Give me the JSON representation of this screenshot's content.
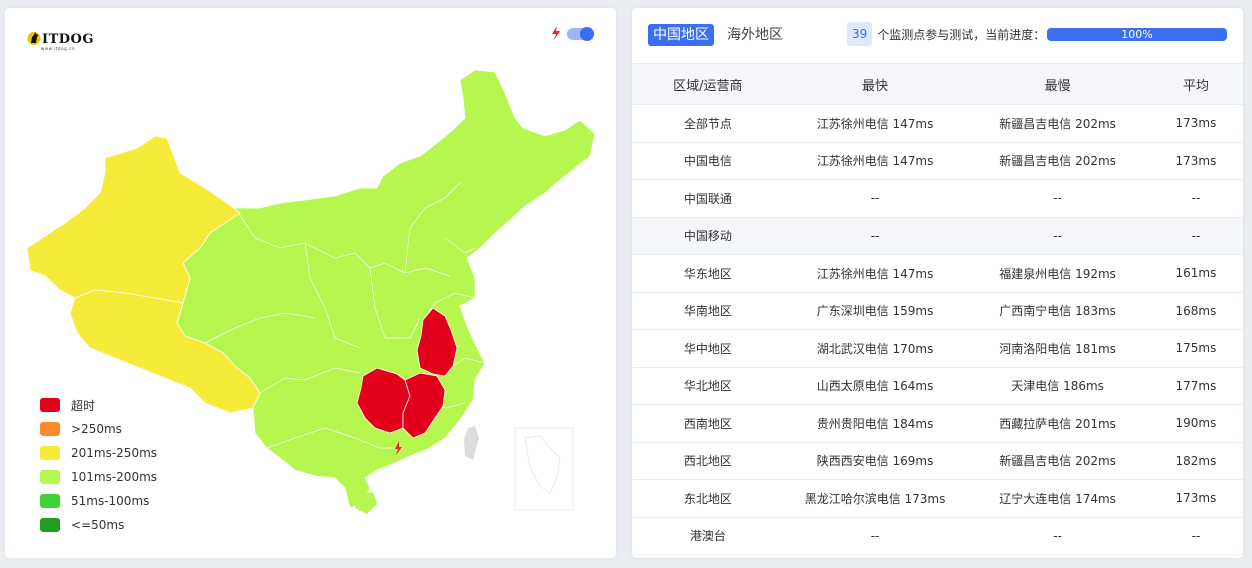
{
  "logo": {
    "text": "ITDOG",
    "sub": "www.itdog.cn"
  },
  "legend": [
    {
      "label": "超时",
      "color": "#e3001b"
    },
    {
      "label": ">250ms",
      "color": "#f98d2b"
    },
    {
      "label": "201ms-250ms",
      "color": "#f7eb39"
    },
    {
      "label": "101ms-200ms",
      "color": "#b5f74e"
    },
    {
      "label": "51ms-100ms",
      "color": "#3fd23b"
    },
    {
      "label": "<=50ms",
      "color": "#219e20"
    }
  ],
  "tabs": {
    "active": "中国地区",
    "inactive": "海外地区"
  },
  "status": {
    "count": "39",
    "text": "个监测点参与测试，当前进度：",
    "progress": "100%"
  },
  "table": {
    "headers": [
      "区域/运营商",
      "最快",
      "最慢",
      "平均"
    ],
    "rows": [
      [
        "全部节点",
        "江苏徐州电信 147ms",
        "新疆昌吉电信 202ms",
        "173ms"
      ],
      [
        "中国电信",
        "江苏徐州电信 147ms",
        "新疆昌吉电信 202ms",
        "173ms"
      ],
      [
        "中国联通",
        "--",
        "--",
        "--"
      ],
      [
        "中国移动",
        "--",
        "--",
        "--"
      ],
      [
        "华东地区",
        "江苏徐州电信 147ms",
        "福建泉州电信 192ms",
        "161ms"
      ],
      [
        "华南地区",
        "广东深圳电信 159ms",
        "广西南宁电信 183ms",
        "168ms"
      ],
      [
        "华中地区",
        "湖北武汉电信 170ms",
        "河南洛阳电信 181ms",
        "175ms"
      ],
      [
        "华北地区",
        "山西太原电信 164ms",
        "天津电信 186ms",
        "177ms"
      ],
      [
        "西南地区",
        "贵州贵阳电信 184ms",
        "西藏拉萨电信 201ms",
        "190ms"
      ],
      [
        "西北地区",
        "陕西西安电信 169ms",
        "新疆昌吉电信 202ms",
        "182ms"
      ],
      [
        "东北地区",
        "黑龙江哈尔滨电信 173ms",
        "辽宁大连电信 174ms",
        "173ms"
      ],
      [
        "港澳台",
        "--",
        "--",
        "--"
      ]
    ]
  },
  "colors": {
    "accent": "#3b6ff0",
    "timeout": "#e3001b",
    "yellow": "#f7eb39",
    "green": "#b5f74e"
  }
}
